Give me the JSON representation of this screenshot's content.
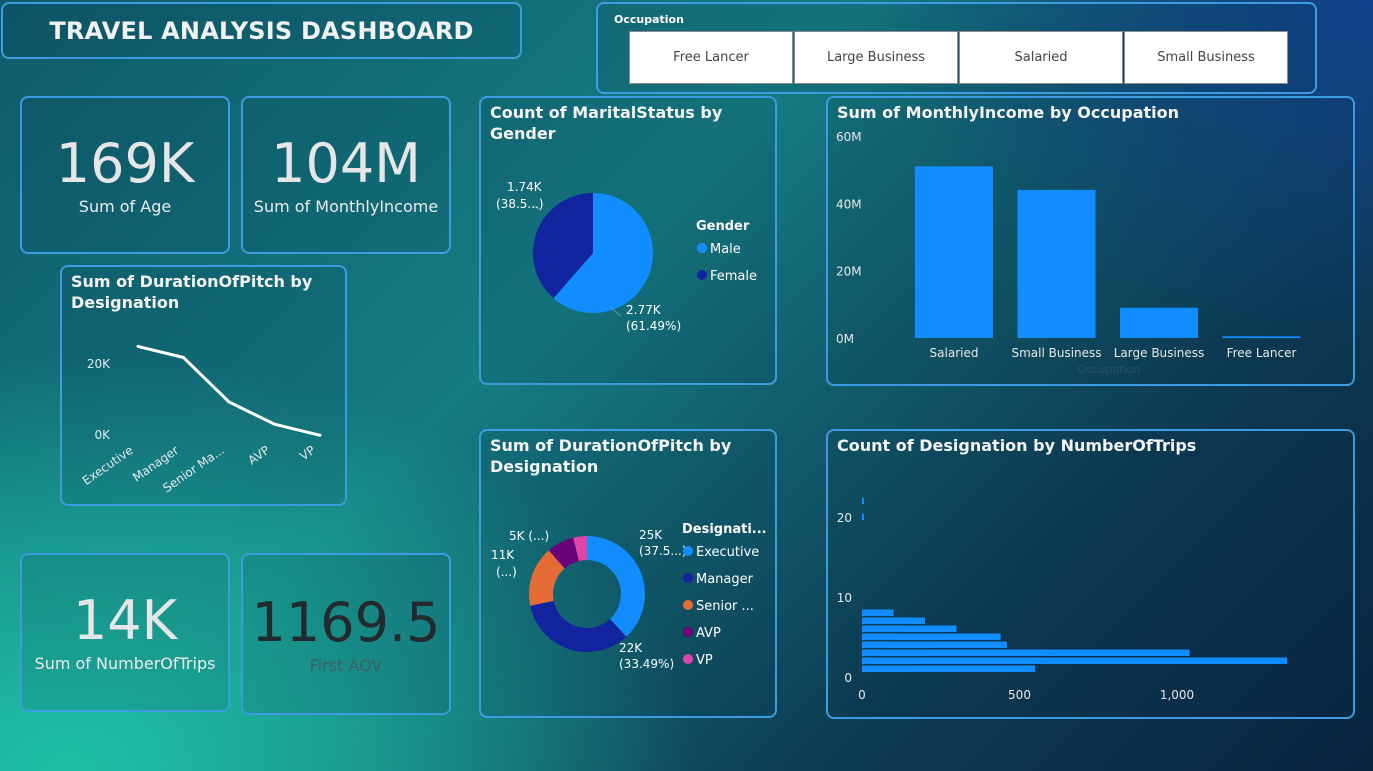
{
  "header": {
    "title": "TRAVEL ANALYSIS DASHBOARD"
  },
  "occupation_slicer": {
    "label": "Occupation",
    "options": [
      "Free Lancer",
      "Large Business",
      "Salaried",
      "Small Business"
    ]
  },
  "kpis": {
    "age": {
      "value": "169K",
      "label": "Sum of Age"
    },
    "income": {
      "value": "104M",
      "label": "Sum of MonthlyIncome"
    },
    "trips": {
      "value": "14K",
      "label": "Sum of NumberOfTrips"
    },
    "aov": {
      "value": "1169.5",
      "label": "First AOV"
    }
  },
  "colors": {
    "accent_blue": "#118dff",
    "dark_blue": "#12239e",
    "orange": "#e66c37",
    "purple": "#6b007b",
    "pink": "#e044a7",
    "border": "#3d9be0"
  },
  "chart_data": [
    {
      "id": "line_pitch",
      "type": "line",
      "title": "Sum of DurationOfPitch by Designation",
      "categories": [
        "Executive",
        "Manager",
        "Senior Ma...",
        "AVP",
        "VP"
      ],
      "values": [
        25000,
        22000,
        10000,
        4000,
        1000
      ],
      "y_ticks": [
        "20K",
        "0K"
      ],
      "grid": false
    },
    {
      "id": "pie_marital",
      "type": "pie",
      "title": "Count of MaritalStatus by Gender",
      "legend_title": "Gender",
      "series": [
        {
          "name": "Male",
          "value": 2770,
          "label1": "2.77K",
          "label2": "(61.49%)"
        },
        {
          "name": "Female",
          "value": 1740,
          "label1": "1.74K",
          "label2": "(38.5...)"
        }
      ],
      "legend_position": "right"
    },
    {
      "id": "bar_income",
      "type": "bar",
      "title": "Sum of MonthlyIncome by Occupation",
      "xlabel": "Occupation",
      "categories": [
        "Salaried",
        "Small Business",
        "Large Business",
        "Free Lancer"
      ],
      "values": [
        51000000,
        44000000,
        9000000,
        500000
      ],
      "y_ticks": [
        "60M",
        "40M",
        "20M",
        "0M"
      ],
      "ylim": [
        0,
        60000000
      ]
    },
    {
      "id": "donut_pitch",
      "type": "pie",
      "title": "Sum of DurationOfPitch by Designation",
      "legend_title": "Designati...",
      "series": [
        {
          "name": "Executive",
          "value": 25,
          "label1": "25K",
          "label2": "(37.5...)"
        },
        {
          "name": "Manager",
          "value": 22,
          "label1": "22K",
          "label2": "(33.49%)"
        },
        {
          "name": "Senior ...",
          "value": 11,
          "label1": "11K",
          "label2": "(...)"
        },
        {
          "name": "AVP",
          "value": 5,
          "label1": "5K (...)",
          "label2": ""
        },
        {
          "name": "VP",
          "value": 2.5,
          "label1": "",
          "label2": ""
        }
      ],
      "legend_position": "right"
    },
    {
      "id": "hbar_trips",
      "type": "bar",
      "orientation": "horizontal",
      "title": "Count of Designation by NumberOfTrips",
      "y": [
        22,
        20,
        8,
        7,
        6,
        5,
        4,
        3,
        2,
        1
      ],
      "values": [
        2,
        2,
        100,
        200,
        300,
        440,
        460,
        1040,
        1350,
        550
      ],
      "x_ticks": [
        "0",
        "500",
        "1,000"
      ],
      "y_ticks": [
        "20",
        "10",
        "0"
      ],
      "xlim": [
        0,
        1400
      ],
      "ylim": [
        0,
        23
      ]
    }
  ]
}
